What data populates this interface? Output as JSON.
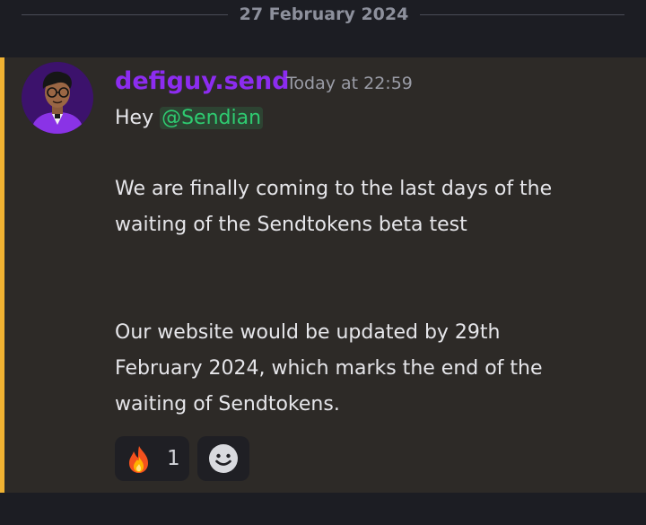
{
  "date_divider": "27 February 2024",
  "message": {
    "author": "defiguy.send",
    "timestamp": "Today at 22:59",
    "greeting": "Hey ",
    "mention": "@Sendian",
    "paragraph1_line1": "We are finally coming to the last days of the",
    "paragraph1_line2": "waiting of the Sendtokens beta test",
    "paragraph2_line1": "Our website would be updated by 29th",
    "paragraph2_line2": "February 2024, which marks the end of the",
    "paragraph2_line3": "waiting of Sendtokens.",
    "reactions": [
      {
        "icon": "fire-icon",
        "count": "1"
      },
      {
        "icon": "add-reaction-icon"
      }
    ]
  },
  "colors": {
    "accent": "#f0b232",
    "author": "#8c2cf0",
    "mention": "#2ecc71"
  }
}
